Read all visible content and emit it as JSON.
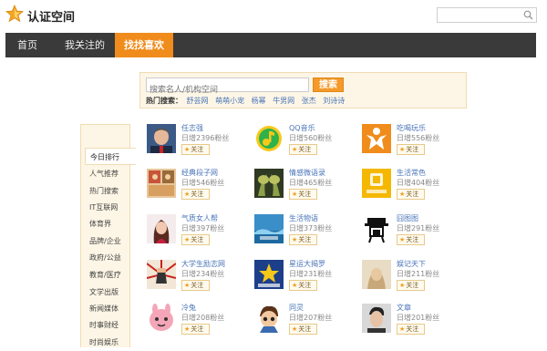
{
  "brand": {
    "title": "认证空间",
    "icon": "star-logo-icon"
  },
  "top_search": {
    "placeholder": "",
    "icon": "search-icon"
  },
  "nav": {
    "items": [
      {
        "label": "首页"
      },
      {
        "label": "我关注的"
      },
      {
        "label": "找找喜欢"
      }
    ],
    "active_index": 2
  },
  "search": {
    "placeholder": "搜索名人/机构空间",
    "button": "搜索",
    "hot_label": "热门搜索：",
    "hot_keywords": [
      "舒芸网",
      "萌萌小宠",
      "杨幂",
      "牛男网",
      "张杰",
      "刘诗诗"
    ]
  },
  "sidebar": {
    "items": [
      "今日排行",
      "人气推荐",
      "热门搜索",
      "IT互联网",
      "体育界",
      "品牌/企业",
      "政府/公益",
      "教育/医疗",
      "文学出版",
      "新闻媒体",
      "时事财经",
      "时尚娱乐"
    ],
    "active_index": 0
  },
  "follow_label": "关注",
  "cards": [
    {
      "name": "任志强",
      "stat": "日增2396粉丝",
      "avatar": "person-photo"
    },
    {
      "name": "QQ音乐",
      "stat": "日增560粉丝",
      "avatar": "qq-music-logo"
    },
    {
      "name": "吃喝玩乐",
      "stat": "日增556粉丝",
      "avatar": "orange-figure-logo"
    },
    {
      "name": "经典段子网",
      "stat": "日增546粉丝",
      "avatar": "comic-photo"
    },
    {
      "name": "情感微语录",
      "stat": "日增465粉丝",
      "avatar": "trees-photo"
    },
    {
      "name": "生活常色",
      "stat": "日增404粉丝",
      "avatar": "yellow-logo"
    },
    {
      "name": "气质女人帮",
      "stat": "日增397粉丝",
      "avatar": "woman-photo"
    },
    {
      "name": "生活物语",
      "stat": "日增373粉丝",
      "avatar": "blue-landscape-logo"
    },
    {
      "name": "囧图图",
      "stat": "日增291粉丝",
      "avatar": "stick-figure-logo"
    },
    {
      "name": "大学生励志网",
      "stat": "日增234粉丝",
      "avatar": "fist-poster"
    },
    {
      "name": "星运大揭罗",
      "stat": "日增231粉丝",
      "avatar": "star-blue-logo"
    },
    {
      "name": "娱记天下",
      "stat": "日增211粉丝",
      "avatar": "tan-photo"
    },
    {
      "name": "冷兔",
      "stat": "日增208粉丝",
      "avatar": "pink-rabbit"
    },
    {
      "name": "同灵",
      "stat": "日增207粉丝",
      "avatar": "cartoon-boy"
    },
    {
      "name": "文章",
      "stat": "日增201粉丝",
      "avatar": "man-photo"
    }
  ],
  "colors": {
    "accent": "#f08c1c",
    "nav_bg": "#3a3a3a",
    "link": "#4a75b8",
    "panel_bg": "#fdf6e6"
  }
}
